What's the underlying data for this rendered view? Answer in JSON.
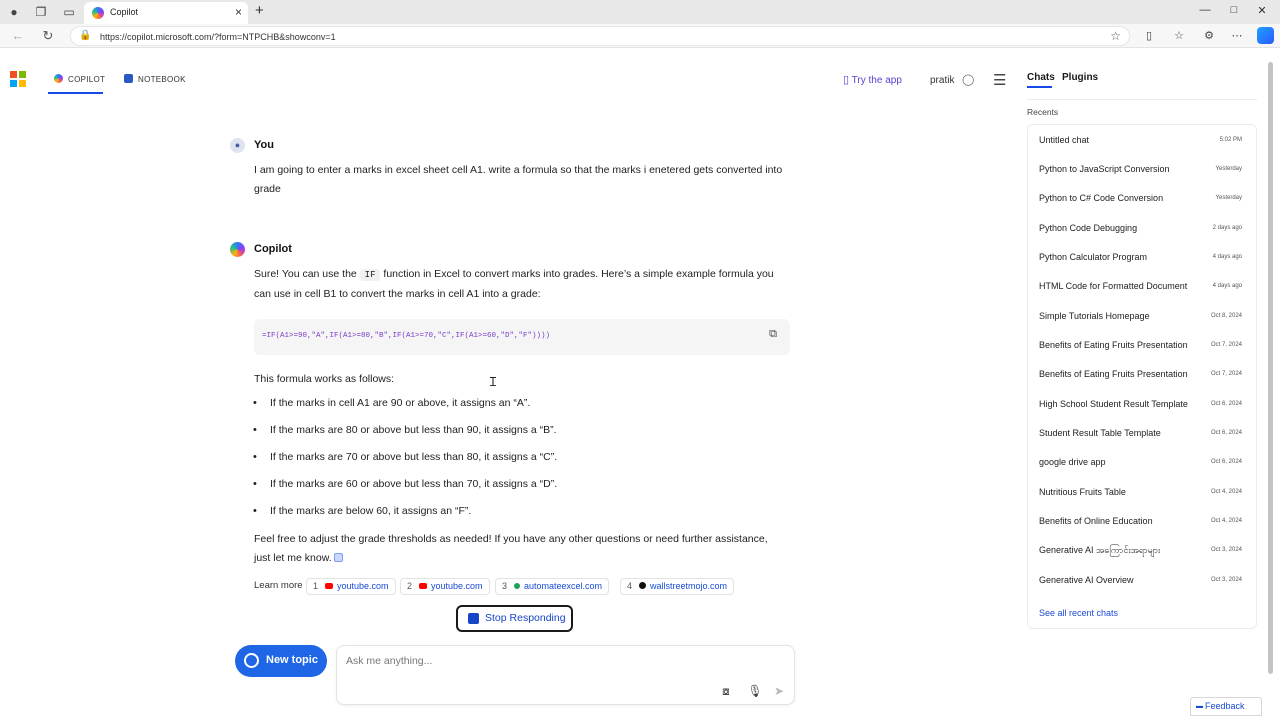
{
  "browser": {
    "tab_title": "Copilot",
    "url": "https://copilot.microsoft.com/?form=NTPCHB&showconv=1"
  },
  "header": {
    "tabs": [
      {
        "label": "COPILOT"
      },
      {
        "label": "NOTEBOOK"
      }
    ],
    "try_app": "Try the app",
    "user_name": "pratik"
  },
  "conversation": {
    "user": {
      "speaker": "You",
      "message": "I am going to enter a marks in excel sheet cell A1. write  a formula so that the marks i enetered gets converted into grade"
    },
    "assistant": {
      "speaker": "Copilot",
      "intro_pre": "Sure! You can use the ",
      "intro_code": "IF",
      "intro_post": " function in Excel to convert marks into grades. Here’s a simple example formula you can use in cell B1 to convert the marks in cell A1 into a grade:",
      "code": "=IF(A1>=90,\"A\",IF(A1>=80,\"B\",IF(A1>=70,\"C\",IF(A1>=60,\"D\",\"F\"))))",
      "explain_heading": "This formula works as follows:",
      "bullets": [
        "If the marks in cell A1 are 90 or above, it assigns an “A”.",
        "If the marks are 80 or above but less than 90, it assigns a “B”.",
        "If the marks are 70 or above but less than 80, it assigns a “C”.",
        "If the marks are 60 or above but less than 70, it assigns a “D”.",
        "If the marks are below 60, it assigns an “F”."
      ],
      "closing": "Feel free to adjust the grade thresholds as needed! If you have any other questions or need further assistance, just let me know.",
      "learn_more": "Learn more",
      "sources": [
        {
          "num": "1",
          "label": "youtube.com"
        },
        {
          "num": "2",
          "label": "youtube.com"
        },
        {
          "num": "3",
          "label": "automateexcel.com"
        },
        {
          "num": "4",
          "label": "wallstreetmojo.com"
        }
      ]
    }
  },
  "controls": {
    "stop_label": "Stop Responding",
    "new_topic": "New topic",
    "input_placeholder": "Ask me anything..."
  },
  "sidebar": {
    "tabs": [
      {
        "label": "Chats"
      },
      {
        "label": "Plugins"
      }
    ],
    "recents_label": "Recents",
    "chats": [
      {
        "title": "Untitled chat",
        "date": "5:02 PM"
      },
      {
        "title": "Python to JavaScript Conversion",
        "date": "Yesterday"
      },
      {
        "title": "Python to C# Code Conversion",
        "date": "Yesterday"
      },
      {
        "title": "Python Code Debugging",
        "date": "2 days ago"
      },
      {
        "title": "Python Calculator Program",
        "date": "4 days ago"
      },
      {
        "title": "HTML Code for Formatted Document",
        "date": "4 days ago"
      },
      {
        "title": "Simple Tutorials Homepage",
        "date": "Oct 8, 2024"
      },
      {
        "title": "Benefits of Eating Fruits Presentation",
        "date": "Oct 7, 2024"
      },
      {
        "title": "Benefits of Eating Fruits Presentation",
        "date": "Oct 7, 2024"
      },
      {
        "title": "High School Student Result Template",
        "date": "Oct 6, 2024"
      },
      {
        "title": "Student Result Table Template",
        "date": "Oct 6, 2024"
      },
      {
        "title": "google drive app",
        "date": "Oct 6, 2024"
      },
      {
        "title": "Nutritious Fruits Table",
        "date": "Oct 4, 2024"
      },
      {
        "title": "Benefits of Online Education",
        "date": "Oct 4, 2024"
      },
      {
        "title": "Generative AI အကြောင်းအရာများ",
        "date": "Oct 3, 2024"
      },
      {
        "title": "Generative AI Overview",
        "date": "Oct 3, 2024"
      }
    ],
    "see_all": "See all recent chats"
  },
  "feedback": "Feedback",
  "colors": {
    "accent": "#174ae4",
    "new_topic_bg": "#1e66e6",
    "link": "#1a4bd6"
  }
}
